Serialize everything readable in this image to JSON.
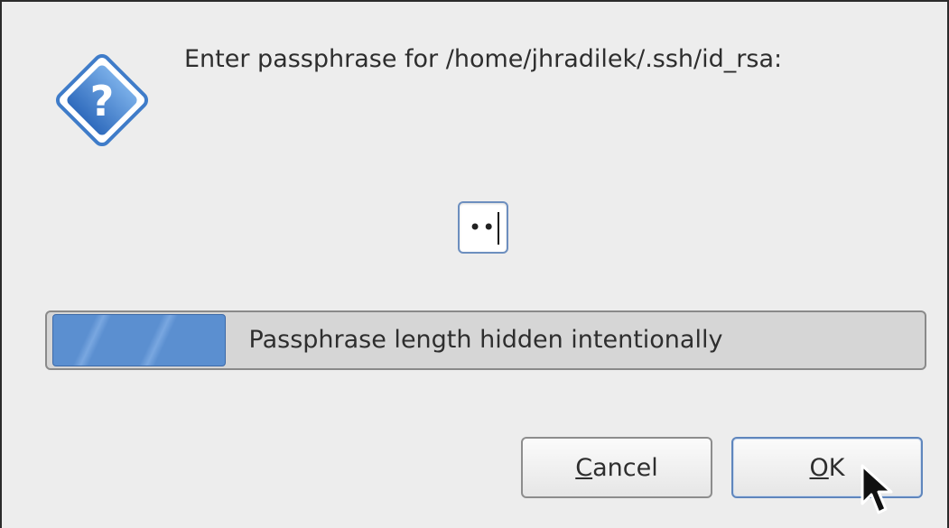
{
  "dialog": {
    "prompt": "Enter passphrase for /home/jhradilek/.ssh/id_rsa:",
    "icon": "question-icon"
  },
  "entry": {
    "masked_value": "••"
  },
  "progress": {
    "text": "Passphrase length hidden intentionally",
    "fraction": 0.2
  },
  "buttons": {
    "cancel": {
      "mnemonic": "C",
      "rest": "ancel"
    },
    "ok": {
      "mnemonic": "O",
      "rest": "K"
    }
  },
  "colors": {
    "accent": "#5b8fd0",
    "icon_blue": "#3f7cc9"
  }
}
